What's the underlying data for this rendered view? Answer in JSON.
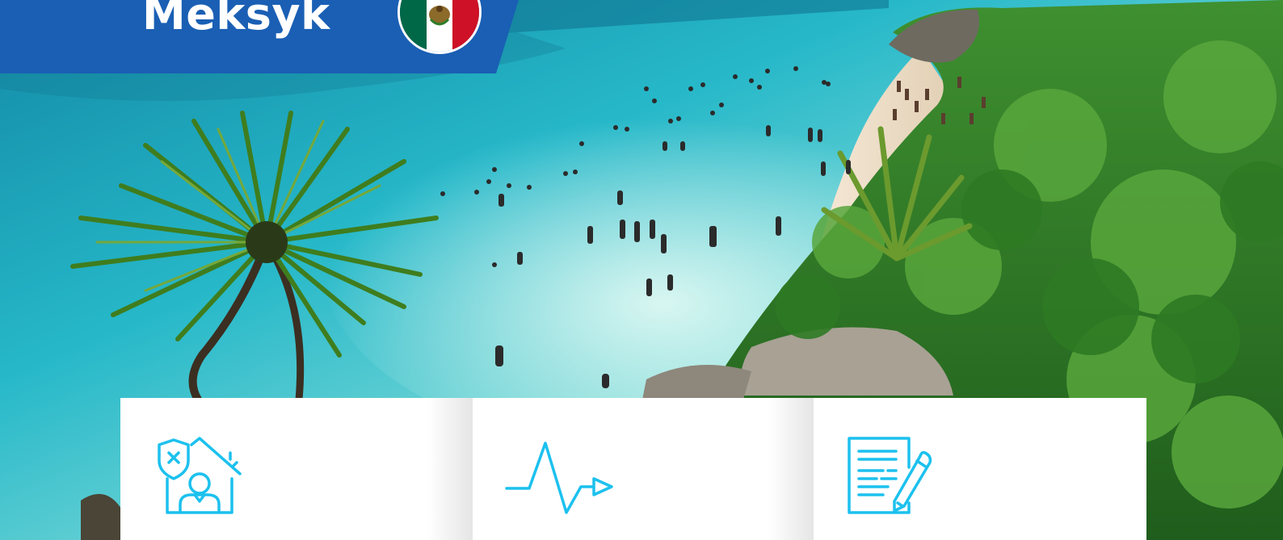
{
  "banner": {
    "title": "Meksyk",
    "color": "#1a5fb4",
    "flag": {
      "name": "mexico-flag",
      "colors": [
        "#006847",
        "#ffffff",
        "#ce1126"
      ],
      "emblem": "eagle-emblem"
    }
  },
  "hero": {
    "scene": "beach-photo",
    "colors": {
      "sea_deep": "#1fa7c4",
      "sea_shallow": "#aeece6",
      "sand": "#f3e3cf",
      "foliage": "#2f7d28",
      "rock": "#9c958a"
    }
  },
  "cards": [
    {
      "icon": "home-protection-icon"
    },
    {
      "icon": "health-pulse-icon"
    },
    {
      "icon": "document-edit-icon"
    }
  ],
  "accent": "#1cc1ee"
}
